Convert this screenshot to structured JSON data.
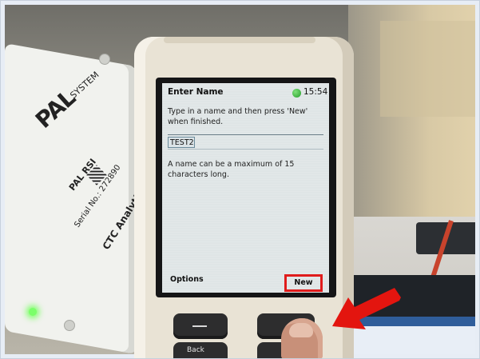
{
  "photo": {
    "pal_box": {
      "logo": "PAL",
      "logo_suffix": "SYSTEM",
      "model": "PAL RSI",
      "serial": "Serial No.: 272890",
      "brand": "CTC Analytics"
    }
  },
  "device_screen": {
    "title": "Enter Name",
    "time": "15:54",
    "prompt": "Type in a name and then press 'New' when finished.",
    "name_value": "TEST2",
    "hint": "A name can be a maximum of 15 characters long.",
    "softkeys": {
      "left": "Options",
      "right": "New"
    }
  },
  "keypad": {
    "back_label": "Back"
  },
  "annotations": {
    "highlight_color": "#e01c1c",
    "arrow_color": "#e3150f"
  }
}
